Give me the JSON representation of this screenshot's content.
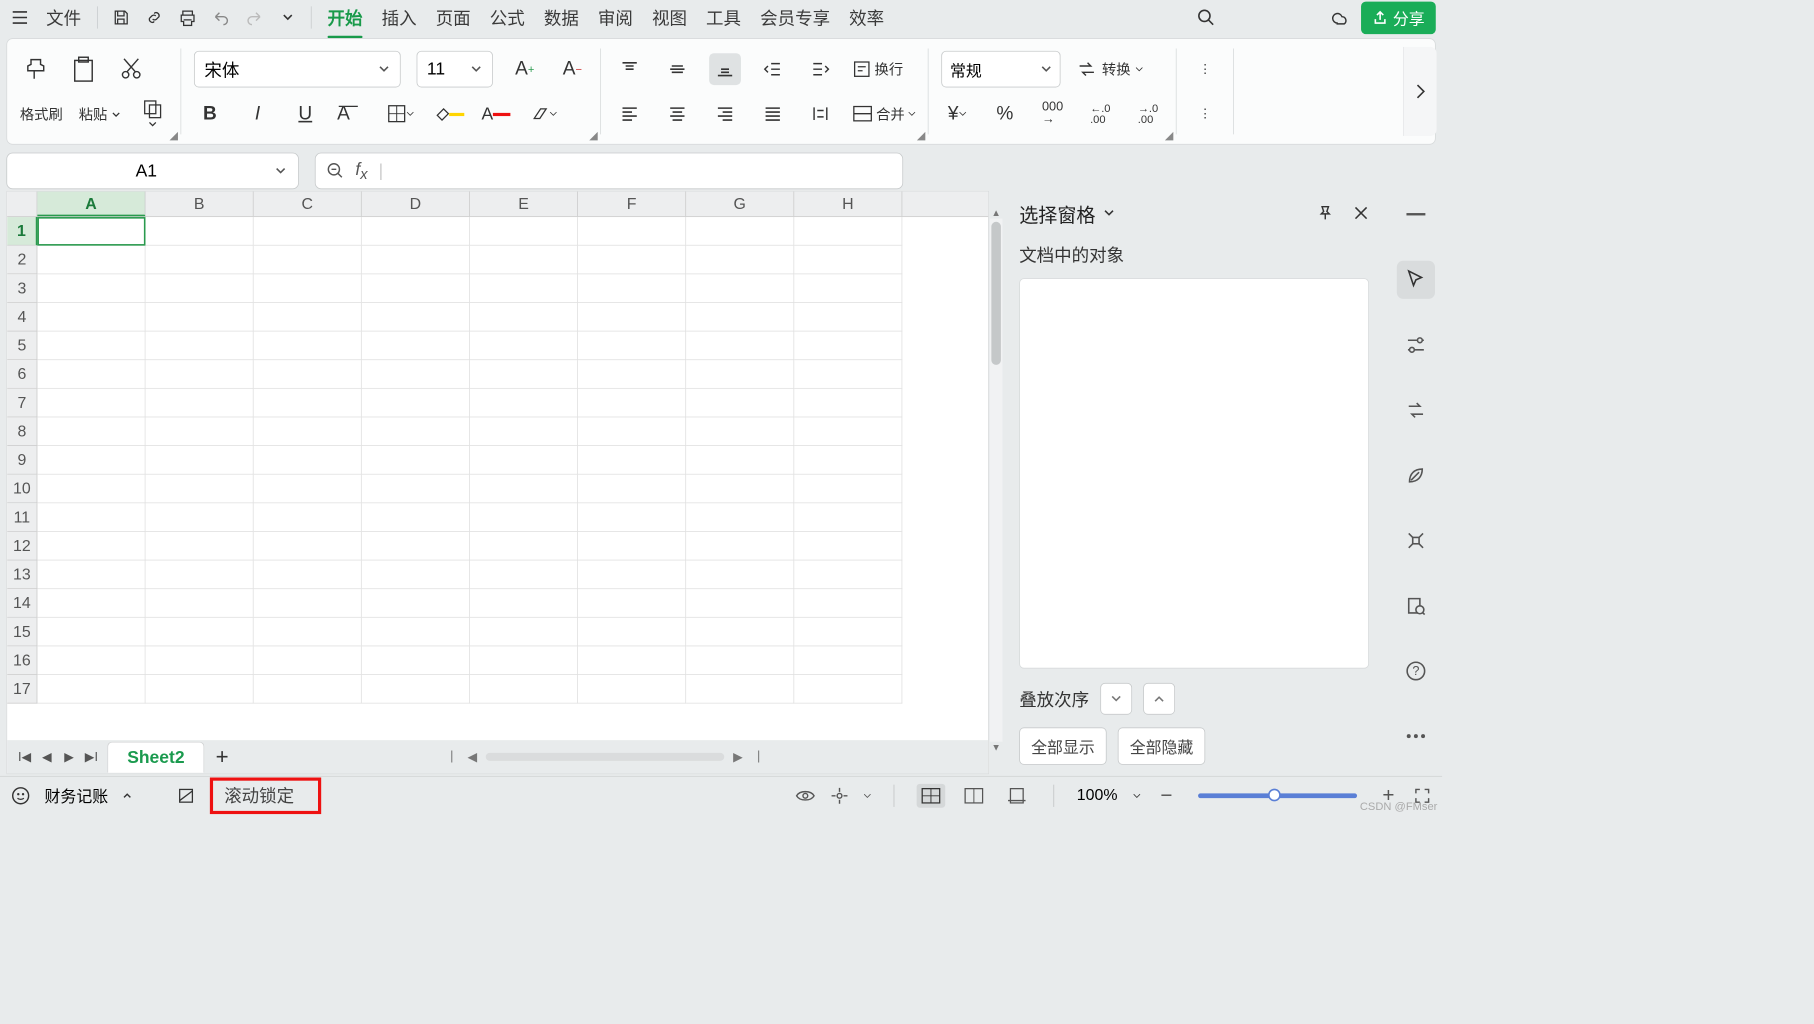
{
  "menubar": {
    "file": "文件",
    "items": [
      "开始",
      "插入",
      "页面",
      "公式",
      "数据",
      "审阅",
      "视图",
      "工具",
      "会员专享",
      "效率"
    ],
    "share": "分享"
  },
  "ribbon": {
    "format_painter": "格式刷",
    "paste": "粘贴",
    "font_name": "宋体",
    "font_size": "11",
    "wrap": "换行",
    "merge": "合并",
    "number_format": "常规",
    "convert": "转换"
  },
  "namebox": {
    "ref": "A1"
  },
  "columns": [
    "A",
    "B",
    "C",
    "D",
    "E",
    "F",
    "G",
    "H"
  ],
  "rows": [
    "1",
    "2",
    "3",
    "4",
    "5",
    "6",
    "7",
    "8",
    "9",
    "10",
    "11",
    "12",
    "13",
    "14",
    "15",
    "16",
    "17"
  ],
  "taskpane": {
    "title": "选择窗格",
    "subtitle": "文档中的对象",
    "order_label": "叠放次序",
    "show_all": "全部显示",
    "hide_all": "全部隐藏"
  },
  "sheettabs": {
    "active": "Sheet2"
  },
  "statusbar": {
    "left_label": "财务记账",
    "scroll_lock": "滚动锁定",
    "zoom": "100%"
  },
  "watermark": "CSDN @FMser"
}
